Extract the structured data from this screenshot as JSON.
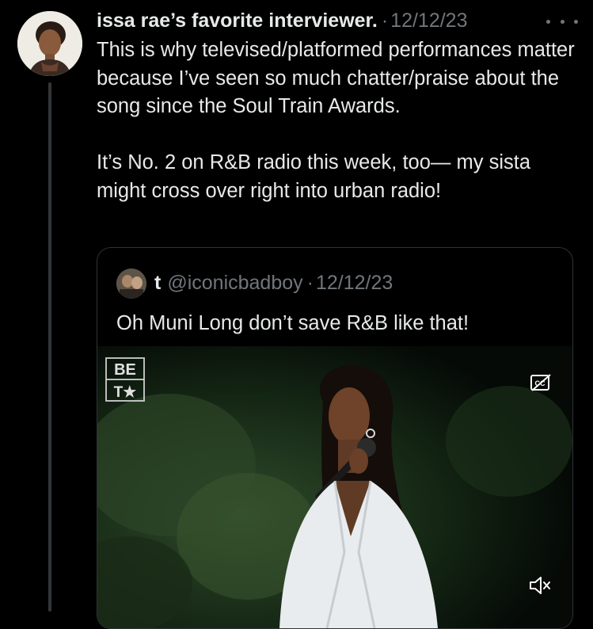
{
  "tweet": {
    "author_name": "issa rae’s favorite interviewer.",
    "separator": "·",
    "date": "12/12/23",
    "paragraphs": [
      "This is why televised/platformed performances matter because I’ve seen so much chatter/praise about the song since the Soul Train Awards.",
      "It’s No. 2 on R&B radio this week, too— my sista might cross over right into urban radio!"
    ],
    "avatar_icon": "profile-photo",
    "more_icon": "more-dots-icon"
  },
  "quote": {
    "author_name": "t",
    "handle": "@iconicbadboy",
    "separator": "·",
    "date": "12/12/23",
    "text": "Oh Muni Long  don’t save R&B like that!",
    "media": {
      "logo_lines": [
        "BE",
        "T★"
      ],
      "captions_icon": "closed-captions-icon",
      "mute_icon": "speaker-muted-icon"
    }
  },
  "colors": {
    "background": "#000000",
    "primary_text": "#e7e9ea",
    "secondary_text": "#71767b",
    "border": "#2f3336",
    "thread_line": "#333639"
  }
}
